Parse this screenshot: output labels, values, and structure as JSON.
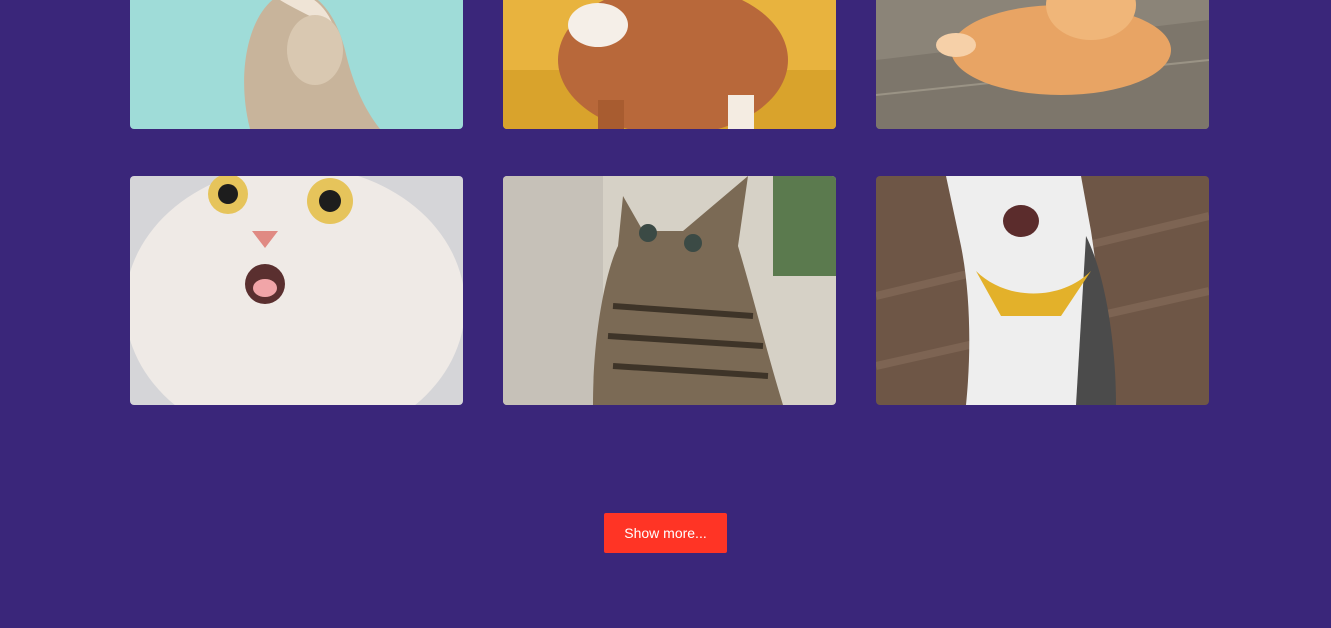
{
  "gallery": {
    "images": [
      {
        "alt": "cat-photo-teal"
      },
      {
        "alt": "cat-photo-yellow"
      },
      {
        "alt": "cat-photo-wood"
      },
      {
        "alt": "cat-photo-white"
      },
      {
        "alt": "cat-photo-kitten"
      },
      {
        "alt": "cat-photo-bandana"
      }
    ]
  },
  "actions": {
    "show_more_label": "Show more..."
  },
  "colors": {
    "background": "#3a267a",
    "button": "#ff3425",
    "button_text": "#ffffff"
  }
}
